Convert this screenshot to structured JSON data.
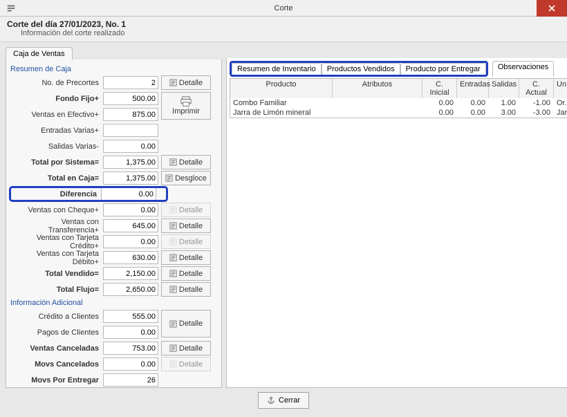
{
  "window": {
    "title": "Corte"
  },
  "header": {
    "title": "Corte del día 27/01/2023, No. 1",
    "subtitle": "Información del corte realizado"
  },
  "left_tab": "Caja de Ventas",
  "sections": {
    "resumen_caja": "Resumen de Caja",
    "info_adicional": "Información Adicional"
  },
  "labels": {
    "no_precortes": "No. de Precortes",
    "fondo_fijo": "Fondo Fijo+",
    "ventas_efectivo": "Ventas en Efectivo+",
    "entradas_varias": "Entradas Varias+",
    "salidas_varias": "Salidas Varias-",
    "total_sistema": "Total por Sistema=",
    "total_caja": "Total en Caja=",
    "diferencia": "Diferencia",
    "ventas_cheque": "Ventas con Cheque+",
    "ventas_transf": "Ventas con Transferencia+",
    "ventas_tcred": "Ventas con Tarjeta Crédito+",
    "ventas_tdeb": "Ventas con Tarjeta Débito+",
    "total_vendido": "Total Vendido=",
    "total_flujo": "Total Flujo=",
    "credito_clientes": "Crédito a Clientes",
    "pagos_clientes": "Pagos de Clientes",
    "ventas_canceladas": "Ventas Canceladas",
    "movs_cancelados": "Movs Cancelados",
    "movs_por_entregar": "Movs Por Entregar"
  },
  "values": {
    "no_precortes": "2",
    "fondo_fijo": "500.00",
    "ventas_efectivo": "875.00",
    "entradas_varias": "",
    "salidas_varias": "0.00",
    "total_sistema": "1,375.00",
    "total_caja": "1,375.00",
    "diferencia": "0.00",
    "ventas_cheque": "0.00",
    "ventas_transf": "645.00",
    "ventas_tcred": "0.00",
    "ventas_tdeb": "630.00",
    "total_vendido": "2,150.00",
    "total_flujo": "2,650.00",
    "credito_clientes": "555.00",
    "pagos_clientes": "0.00",
    "ventas_canceladas": "753.00",
    "movs_cancelados": "0.00",
    "movs_por_entregar": "26"
  },
  "buttons": {
    "detalle": "Detalle",
    "imprimir": "Imprimir",
    "desgloce": "Desgloce",
    "cerrar": "Cerrar"
  },
  "right_tabs": {
    "resumen_inv": "Resumen de Inventario",
    "prod_vendidos": "Productos Vendidos",
    "prod_entregar": "Producto por Entregar",
    "observaciones": "Observaciones"
  },
  "grid": {
    "headers": {
      "producto": "Producto",
      "atributos": "Atributos",
      "c_inicial": "C. Inicial",
      "entradas": "Entradas",
      "salidas": "Salidas",
      "c_actual": "C. Actual",
      "un": "Un"
    },
    "rows": [
      {
        "producto": "Combo Familiar",
        "atributos": "",
        "c_inicial": "0.00",
        "entradas": "0.00",
        "salidas": "1.00",
        "c_actual": "-1.00",
        "un": "Or..."
      },
      {
        "producto": "Jarra de Limón mineral",
        "atributos": "",
        "c_inicial": "0.00",
        "entradas": "0.00",
        "salidas": "3.00",
        "c_actual": "-3.00",
        "un": "Jarra"
      }
    ]
  }
}
